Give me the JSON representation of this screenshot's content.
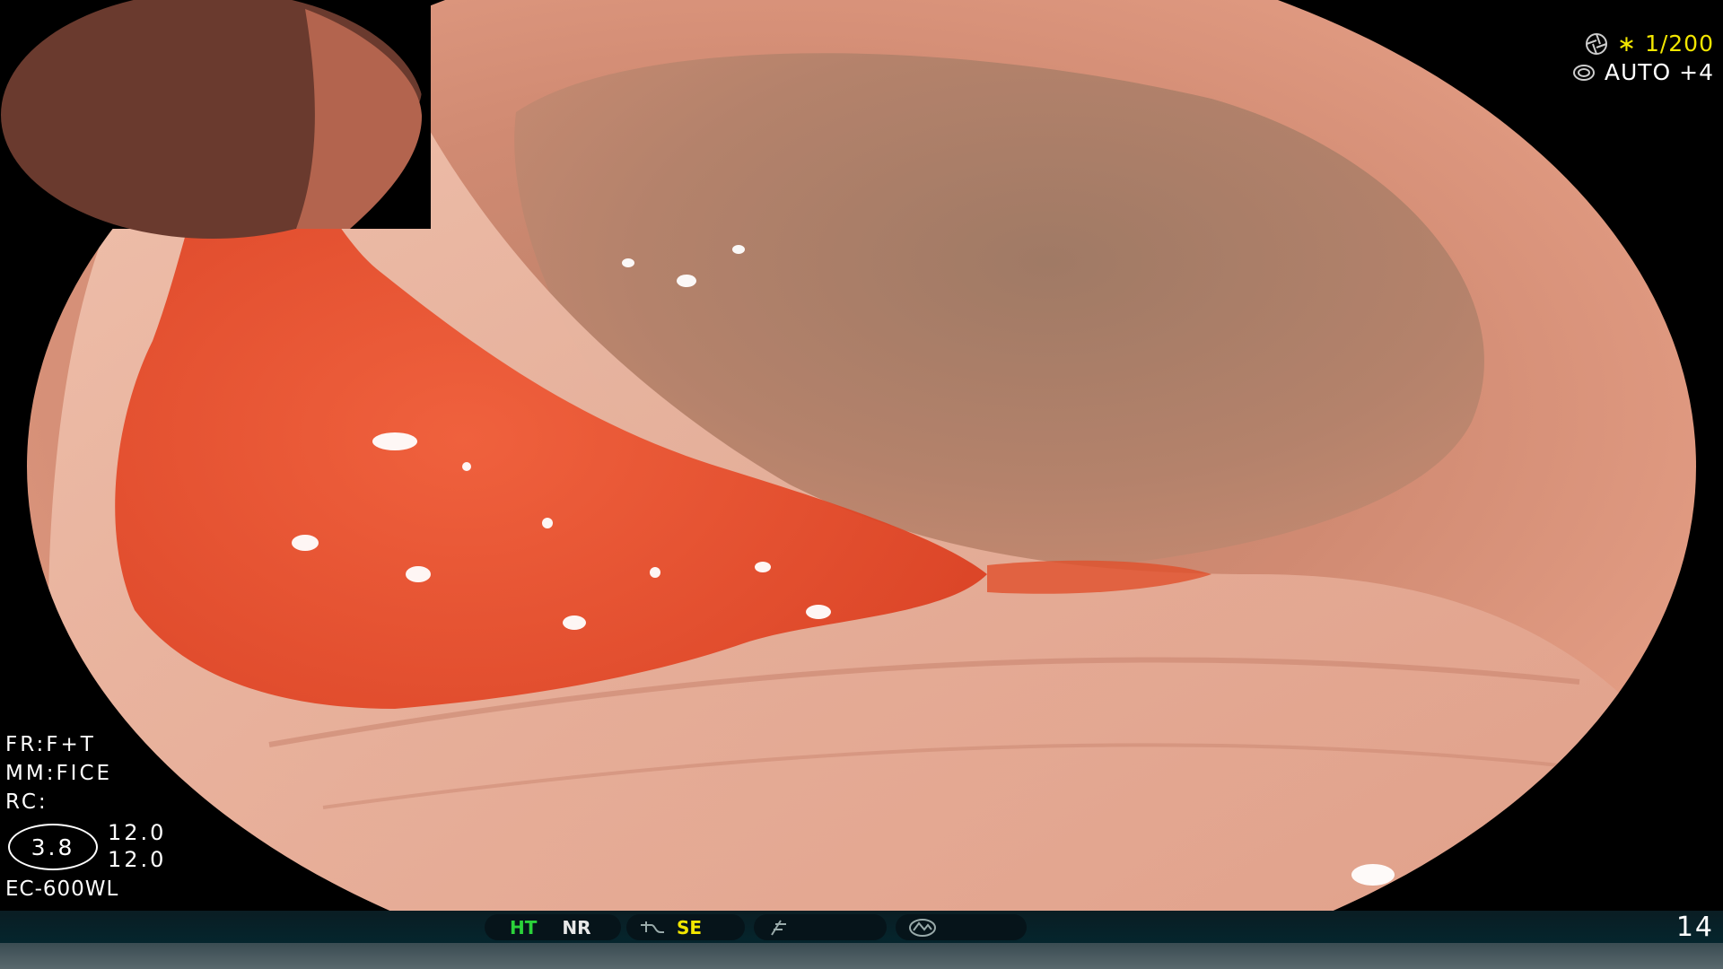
{
  "colors": {
    "background": "#000000",
    "mucosa": "#e0927a",
    "blood": "#e8401f",
    "shutter_text": "#f2e600",
    "ht_text": "#2bd23a",
    "se_text": "#f2e600",
    "status_bar": "#04262e"
  },
  "readouts": {
    "shutter": "∗ 1/200",
    "exposure": "AUTO +4"
  },
  "settings": {
    "fr": "FR:F+T",
    "mm": "MM:FICE",
    "rc": "RC:"
  },
  "zoom": {
    "oval_value": "3.8",
    "value_1": "12.0",
    "value_2": "12.0"
  },
  "model": "EC-600WL",
  "status_bar": {
    "ht": "HT",
    "nr": "NR",
    "se": "SE",
    "frame_number": "14"
  },
  "icons": {
    "shutter_icon": "aperture-icon",
    "exposure_icon": "iris-icon",
    "enhance_icon": "wave-icon",
    "slash_icon": "freeze-icon",
    "light_icon": "light-mode-icon"
  }
}
